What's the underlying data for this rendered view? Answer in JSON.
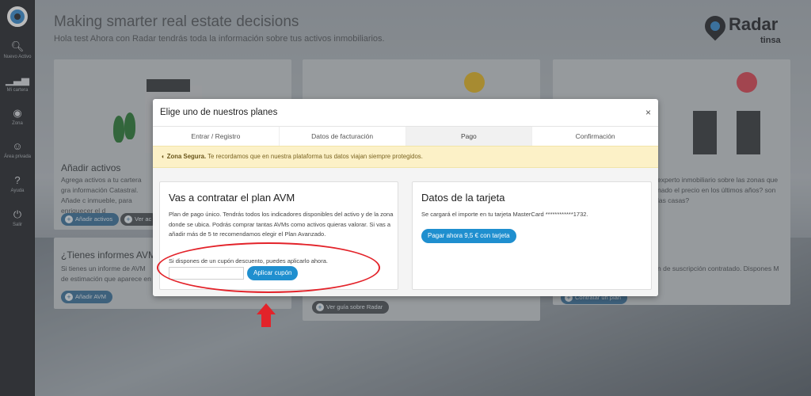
{
  "header": {
    "title": "Making smarter real estate decisions",
    "subtitle": "Hola test Ahora con Radar tendrás toda la información sobre tus activos inmobiliarios."
  },
  "brand": {
    "name": "Radar",
    "byline": "tinsa"
  },
  "sidebar": {
    "items": [
      {
        "label": "Nuevo Activo",
        "icon": "add-search-icon"
      },
      {
        "label": "Mi cartera",
        "icon": "chart-icon"
      },
      {
        "label": "Zona",
        "icon": "target-icon"
      },
      {
        "label": "Área privada",
        "icon": "user-icon"
      },
      {
        "label": "Ayuda",
        "icon": "help-icon"
      },
      {
        "label": "Salir",
        "icon": "power-icon"
      }
    ]
  },
  "background_cards": {
    "add_assets": {
      "title": "Añadir activos",
      "text": "Agrega activos a tu cartera gra información Catastral. Añade c inmueble, para enriquecer el d",
      "button_add": "Añadir activos",
      "button_view": "Ver ac"
    },
    "reports": {
      "title": "¿Tienes informes AVM?",
      "text": "Si tienes un informe de AVM de estimación que aparece en",
      "text_bold": "AVM",
      "button": "Añadir AVM"
    },
    "expert": {
      "text": "experto inmobiliario sobre las zonas que nado el precio en los últimos años? son las casas?"
    },
    "subscription": {
      "text": "n de suscripción contratado. Dispones M",
      "button": "Contratar un plan"
    },
    "guide_button": "Ver guía sobre Radar"
  },
  "modal": {
    "title": "Elige uno de nuestros planes",
    "close_icon": "×",
    "tabs": [
      "Entrar / Registro",
      "Datos de facturación",
      "Pago",
      "Confirmación"
    ],
    "active_tab": "Pago",
    "alert": {
      "bold": "Zona Segura.",
      "text": " Te recordamos que en nuestra plataforma tus datos viajan siempre protegidos."
    },
    "plan_panel": {
      "title": "Vas a contratar el plan AVM",
      "description": "Plan de pago único. Tendrás todos los indicadores disponibles del activo y de la zona donde se ubica. Podrás comprar tantas AVMs como activos quieras valorar. Si vas a añadir más de 5 te recomendamos elegir el Plan Avanzado.",
      "coupon_label": "Si dispones de un cupón descuento, puedes aplicarlo ahora.",
      "coupon_value": "",
      "coupon_placeholder": "",
      "apply_button": "Aplicar cupón"
    },
    "card_panel": {
      "title": "Datos de la tarjeta",
      "description": "Se cargará el importe en tu tarjeta MasterCard ************1732.",
      "pay_button": "Pagar ahora 9,5 € con tarjeta"
    }
  },
  "colors": {
    "accent": "#1f8fcf",
    "annotation": "#e3232a",
    "alert_bg": "#fcf1c7"
  }
}
